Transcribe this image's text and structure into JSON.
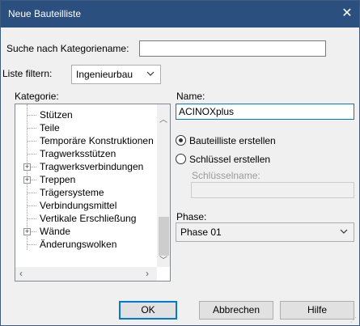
{
  "window": {
    "title": "Neue Bauteilliste",
    "close_glyph": "✕"
  },
  "search": {
    "label": "Suche nach Kategoriename:",
    "value": ""
  },
  "filter": {
    "label": "Liste filtern:",
    "selected": "Ingenieurbau"
  },
  "category": {
    "label": "Kategorie:",
    "items": [
      {
        "label": "Stützen",
        "expandable": false
      },
      {
        "label": "Teile",
        "expandable": false
      },
      {
        "label": "Temporäre Konstruktionen",
        "expandable": false
      },
      {
        "label": "Tragwerksstützen",
        "expandable": false
      },
      {
        "label": "Tragwerksverbindungen",
        "expandable": true
      },
      {
        "label": "Treppen",
        "expandable": true
      },
      {
        "label": "Trägersysteme",
        "expandable": false
      },
      {
        "label": "Verbindungsmittel",
        "expandable": false
      },
      {
        "label": "Vertikale Erschließung",
        "expandable": false
      },
      {
        "label": "Wände",
        "expandable": true
      },
      {
        "label": "Änderungswolken",
        "expandable": false
      }
    ]
  },
  "name": {
    "label": "Name:",
    "value": "ACINOXplus"
  },
  "options": {
    "create_list": "Bauteilliste erstellen",
    "create_key": "Schlüssel erstellen",
    "selected": "create_list"
  },
  "key_name": {
    "label": "Schlüsselname:",
    "value": ""
  },
  "phase": {
    "label": "Phase:",
    "selected": "Phase 01"
  },
  "buttons": {
    "ok": "OK",
    "cancel": "Abbrechen",
    "help": "Hilfe"
  }
}
